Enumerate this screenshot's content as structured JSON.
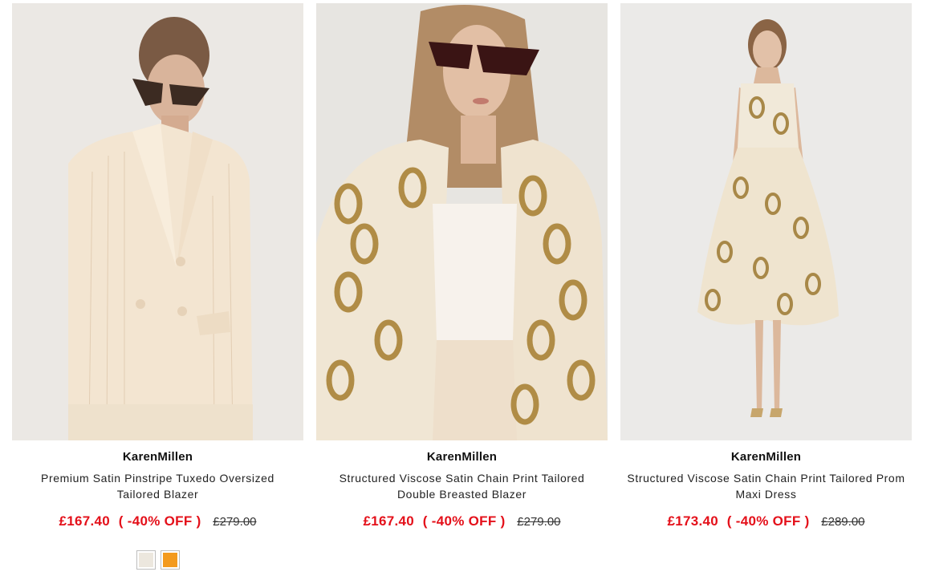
{
  "products": [
    {
      "brand": "KarenMillen",
      "name": "Premium Satin Pinstripe Tuxedo Oversized Tailored Blazer",
      "price": "£167.40",
      "discount": "( -40% OFF )",
      "was_price": "£279.00",
      "swatches": [
        {
          "color": "#ece7de"
        },
        {
          "color": "#f39a1e"
        }
      ]
    },
    {
      "brand": "KarenMillen",
      "name": "Structured Viscose Satin Chain Print Tailored Double Breasted Blazer",
      "price": "£167.40",
      "discount": "( -40% OFF )",
      "was_price": "£279.00"
    },
    {
      "brand": "KarenMillen",
      "name": "Structured Viscose Satin Chain Print Tailored Prom Maxi Dress",
      "price": "£173.40",
      "discount": "( -40% OFF )",
      "was_price": "£289.00"
    }
  ],
  "colors": {
    "sale_red": "#e4101a",
    "image_bg": "#e9e7e4"
  }
}
